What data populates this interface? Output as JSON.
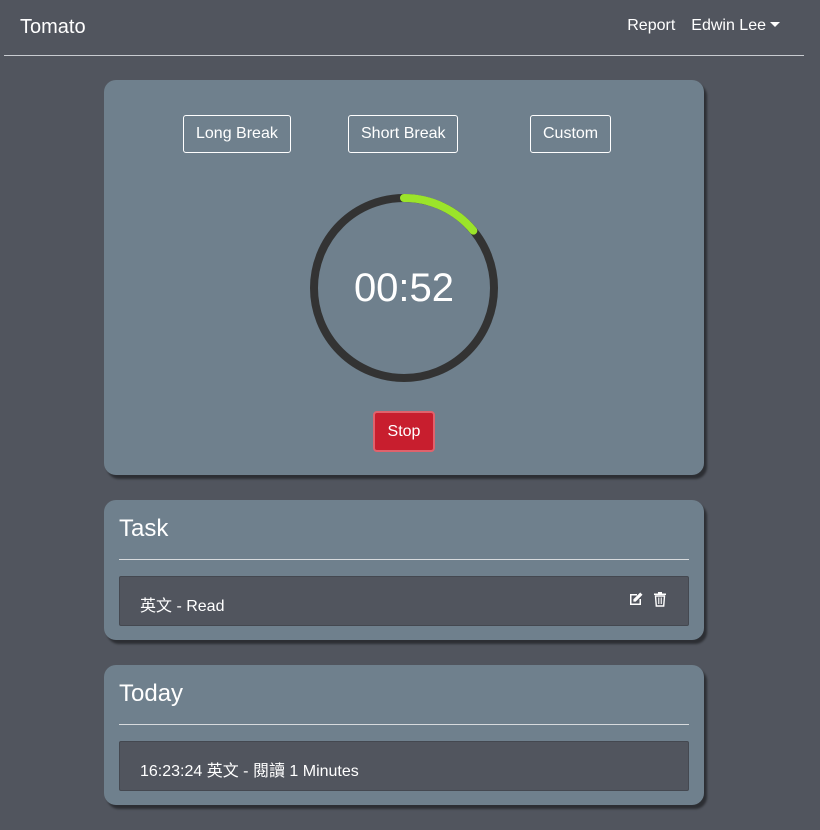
{
  "navbar": {
    "brand": "Tomato",
    "report": "Report",
    "user": "Edwin Lee"
  },
  "timer": {
    "modes": [
      "Long Break",
      "Short Break",
      "Custom"
    ],
    "time": "00:52",
    "progress": 0.14,
    "stop_label": "Stop",
    "colors": {
      "ring": "#333333",
      "progress": "#9be42a",
      "stop": "#c81e2e"
    }
  },
  "task": {
    "title": "Task",
    "items": [
      {
        "text": "英文 - Read"
      }
    ]
  },
  "today": {
    "title": "Today",
    "items": [
      {
        "text": "16:23:24 英文 - 閱讀 1 Minutes"
      }
    ]
  }
}
